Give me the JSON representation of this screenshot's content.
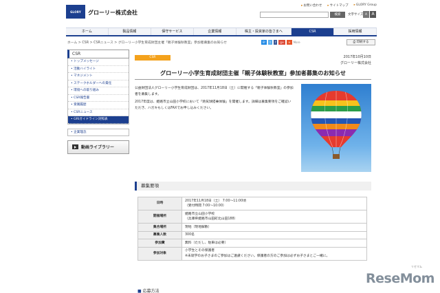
{
  "header": {
    "logo_text": "GLORY",
    "brand": "グローリー株式会社",
    "utility_links": [
      "お問い合わせ",
      "サイトマップ",
      "GLORY Group"
    ],
    "search_button": "検索",
    "text_size_label": "文字サイズ",
    "text_sizes": [
      "A",
      "A",
      "A"
    ]
  },
  "nav": {
    "items": [
      "ホーム",
      "製品情報",
      "保守サービス",
      "企業情報",
      "株主・投資家の皆さまへ",
      "CSR",
      "採用情報"
    ],
    "active": "CSR"
  },
  "breadcrumb": "ホーム > CSR > CSRニュース > グローリー小学生育成財団主催「親子体験秋教室」参加者募集のお知らせ",
  "share": {
    "items": [
      "B!",
      "t",
      "f",
      "g+",
      "+",
      "More"
    ],
    "colors": [
      "#1e88e5",
      "#55acee",
      "#3b5998",
      "#dd4b39",
      "#e8552a",
      "#888888"
    ],
    "print_button": "印刷する"
  },
  "sidebar": {
    "heading": "CSR",
    "items": [
      "トップメッセージ",
      "活動ハイライト",
      "マネジメント",
      "ステークホルダーへの責任",
      "環境への取り組み",
      "CSR報告書",
      "受賞履歴",
      "CSRニュース",
      "GRIガイドライン対照表"
    ],
    "active_index": 8,
    "extra_link": "企業理念",
    "video_button": "動画ライブラリー"
  },
  "article": {
    "category": "CSR",
    "date": "2017年10月10日",
    "publisher": "グローリー株式会社",
    "title": "グローリー小学生育成財団主催「親子体験秋教室」参加者募集のお知らせ",
    "paragraphs": [
      "公益財団法人グローリー小学生育成財団は、2017年11月18日（土）に開催する「親子体験秋教室」の参加者を募集します。",
      "2017年度は、姫路市立山田小学校において「熱気球搭乗体験」を開催します。詳細は募集要項をご確認いただき、ハガキもしくはFAXでお申し込みください。"
    ],
    "photo_alt": "熱気球"
  },
  "outline": {
    "heading": "募集要項",
    "rows": [
      {
        "label": "日時",
        "value": "2017年11月18日（土） 7:00〜11:00頃\n（受付時間 7:00〜10:00）"
      },
      {
        "label": "開催場所",
        "value": "姫路市立山田小学校\n（兵庫県姫路市山田町北山田188）"
      },
      {
        "label": "集合場所",
        "value": "現地（現地解散）"
      },
      {
        "label": "募集人数",
        "value": "300名"
      },
      {
        "label": "参加費",
        "value": "無料（ただし、駐車は必要）"
      },
      {
        "label": "参加対象",
        "value": "小学生とその保護者\n※未就学のお子さまのご参加はご遠慮ください。保護者の方のご参加は必ずお子さまとご一緒に。"
      }
    ],
    "apply_heading": "応募方法"
  },
  "watermark": {
    "text": "ReseMom",
    "site": "リセマム"
  }
}
